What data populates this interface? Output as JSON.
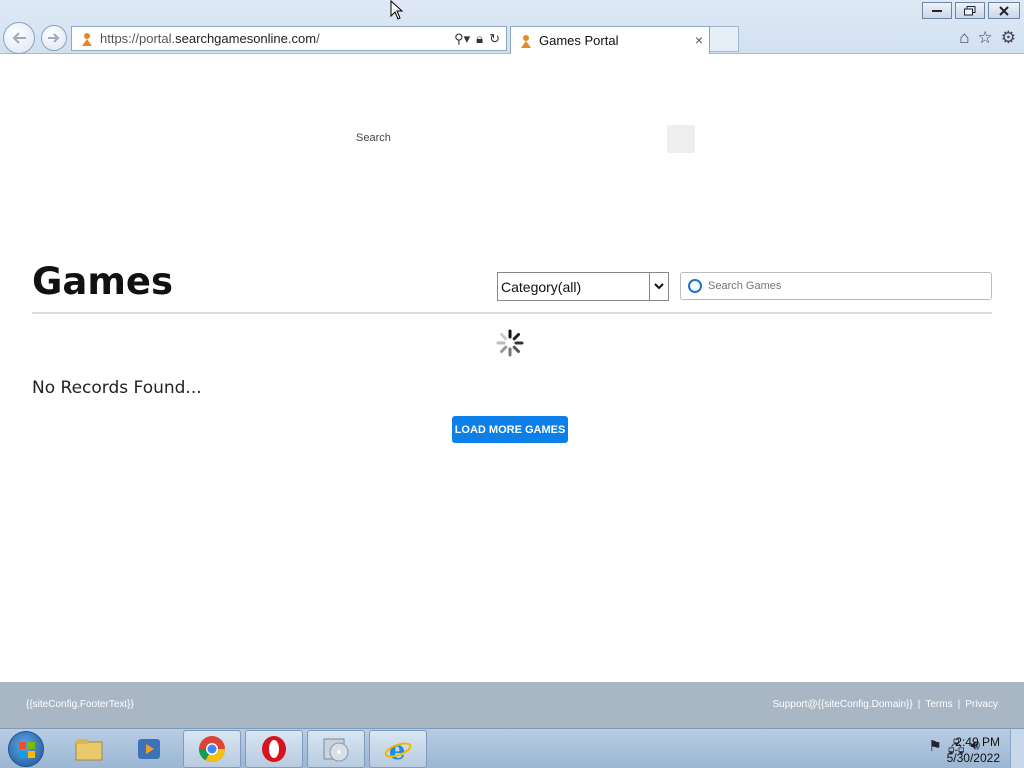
{
  "browser": {
    "url_prefix": "https://portal.",
    "url_domain": "searchgamesonline.com",
    "url_suffix": "/",
    "tab_title": "Games Portal",
    "tab_close": "×"
  },
  "page": {
    "top_search_label": "Search",
    "title": "Games",
    "category_select": "Category(all)",
    "search_placeholder": "Search Games",
    "no_records": "No Records Found...",
    "load_more": "LOAD MORE GAMES"
  },
  "footer": {
    "text": "{{siteConfig.FooterText}}",
    "support": "Support@{{siteConfig.Domain}}",
    "sep1": "|",
    "terms": "Terms",
    "sep2": "|",
    "privacy": "Privacy"
  },
  "taskbar": {
    "time": "2:49 PM",
    "date": "5/30/2022",
    "items": [
      "file-explorer-icon",
      "media-player-icon",
      "chrome-icon",
      "opera-icon",
      "cd-burner-icon",
      "internet-explorer-icon"
    ]
  },
  "colors": {
    "accent": "#0d7fe8",
    "footer_bg": "#a9b7c4"
  }
}
